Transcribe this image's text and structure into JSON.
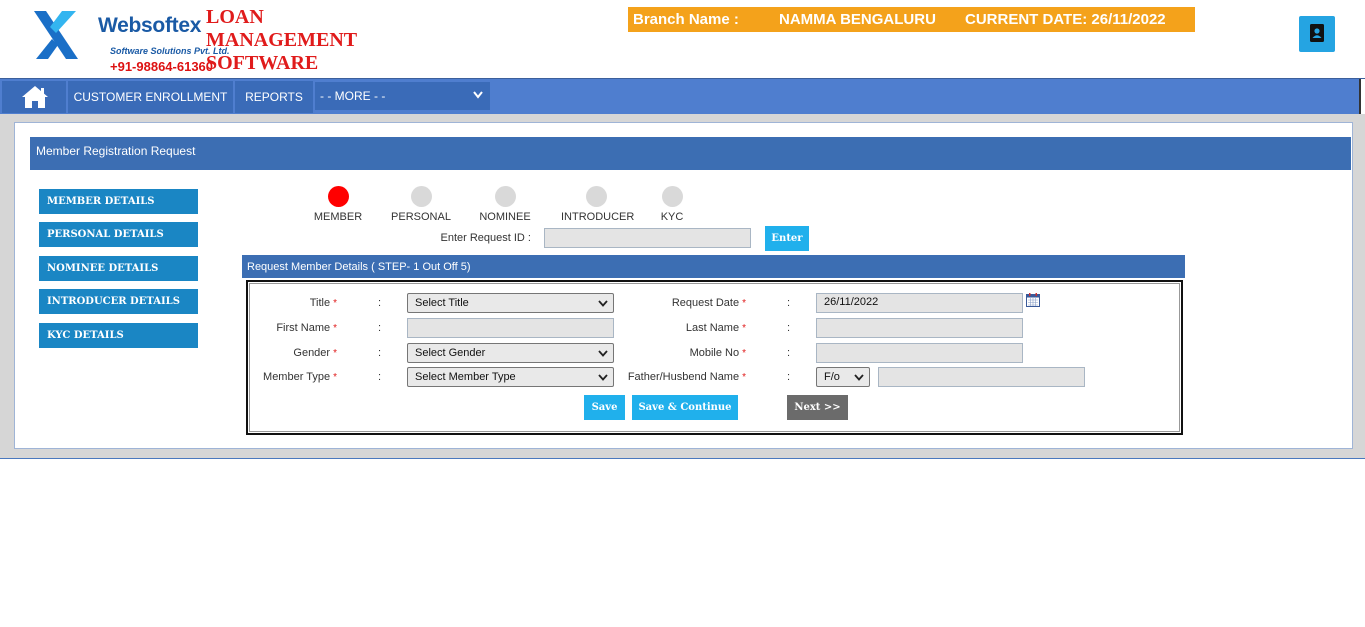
{
  "header": {
    "brand": "Websoftex",
    "brand_sub": "Software Solutions Pvt. Ltd.",
    "phone": "+91-98864-61360",
    "app_title_1": "LOAN",
    "app_title_2": "MANAGEMENT",
    "app_title_3": "SOFTWARE",
    "branch_label": "Branch Name :",
    "branch_name": "NAMMA BENGALURU",
    "current_date": "CURRENT DATE: 26/11/2022",
    "profile_icon": "contact-book-icon"
  },
  "nav": {
    "home_icon": "home-icon",
    "customer_enrollment": "CUSTOMER ENROLLMENT",
    "reports": "REPORTS",
    "more": "- - MORE - -"
  },
  "panel": {
    "title": "Member Registration Request"
  },
  "sidebar": {
    "items": [
      {
        "label": "MEMBER DETAILS"
      },
      {
        "label": "PERSONAL DETAILS"
      },
      {
        "label": "NOMINEE DETAILS"
      },
      {
        "label": "INTRODUCER DETAILS"
      },
      {
        "label": "KYC DETAILS"
      }
    ]
  },
  "steps": [
    {
      "label": "MEMBER",
      "active": true
    },
    {
      "label": "PERSONAL",
      "active": false
    },
    {
      "label": "NOMINEE",
      "active": false
    },
    {
      "label": "INTRODUCER",
      "active": false
    },
    {
      "label": "KYC",
      "active": false
    }
  ],
  "request": {
    "label": "Enter Request ID :",
    "value": "",
    "enter_button": "Enter"
  },
  "form": {
    "section_title": "Request Member Details ( STEP- 1 Out Off 5)",
    "colon": ":",
    "title_label": "Title",
    "title_value": "Select Title",
    "request_date_label": "Request Date",
    "request_date_value": "26/11/2022",
    "first_name_label": "First Name",
    "first_name_value": "",
    "last_name_label": "Last Name",
    "last_name_value": "",
    "gender_label": "Gender",
    "gender_value": "Select Gender",
    "mobile_label": "Mobile No",
    "mobile_value": "",
    "member_type_label": "Member Type",
    "member_type_value": "Select Member Type",
    "father_label": "Father/Husbend Name",
    "relation_value": "F/o",
    "father_value": "",
    "required_mark": "*",
    "save_button": "Save",
    "save_continue_button": "Save & Continue",
    "next_button": "Next >>"
  },
  "colors": {
    "accent_blue": "#1a86c4",
    "header_blue": "#3c6eb3",
    "nav_blue": "#4f7ecf",
    "branch_orange": "#f4a21b",
    "active_step": "#ff0000",
    "brand_red": "#e01b1b"
  }
}
